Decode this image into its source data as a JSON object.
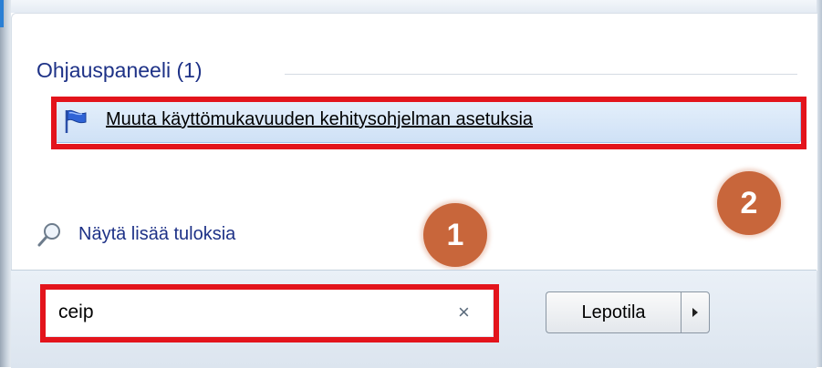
{
  "results": {
    "group_header": "Ohjauspaneeli (1)",
    "items": [
      {
        "label": "Muuta käyttömukavuuden kehitysohjelman asetuksia",
        "icon": "flag-icon"
      }
    ],
    "see_more_label": "Näytä lisää tuloksia",
    "see_more_icon": "magnifier-icon"
  },
  "search": {
    "value": "ceip",
    "clear_glyph": "×"
  },
  "power": {
    "button_label": "Lepotila",
    "arrow_icon": "triangle-right-icon"
  },
  "callouts": {
    "badge_1": "1",
    "badge_2": "2",
    "color": "#c8663b",
    "highlight_color": "#e3141c"
  },
  "colors": {
    "header_text": "#1e3287",
    "selection_fill": "#cfe1f6"
  }
}
